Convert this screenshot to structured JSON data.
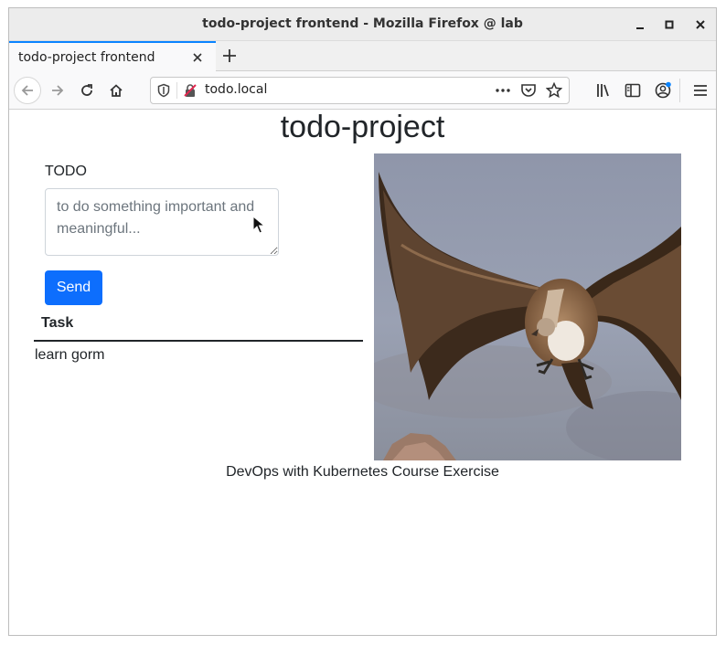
{
  "window": {
    "title": "todo-project frontend - Mozilla Firefox @ lab"
  },
  "tabs": [
    {
      "label": "todo-project frontend"
    }
  ],
  "navbar": {
    "url": "todo.local"
  },
  "page": {
    "title": "todo-project",
    "form": {
      "label": "TODO",
      "placeholder": "to do something important and meaningful...",
      "send_label": "Send"
    },
    "table": {
      "header": "Task",
      "rows": [
        "learn gorm"
      ]
    },
    "footer": "DevOps with Kubernetes Course Exercise"
  },
  "colors": {
    "accent": "#0d6efd",
    "tab_highlight": "#0a84ff"
  }
}
